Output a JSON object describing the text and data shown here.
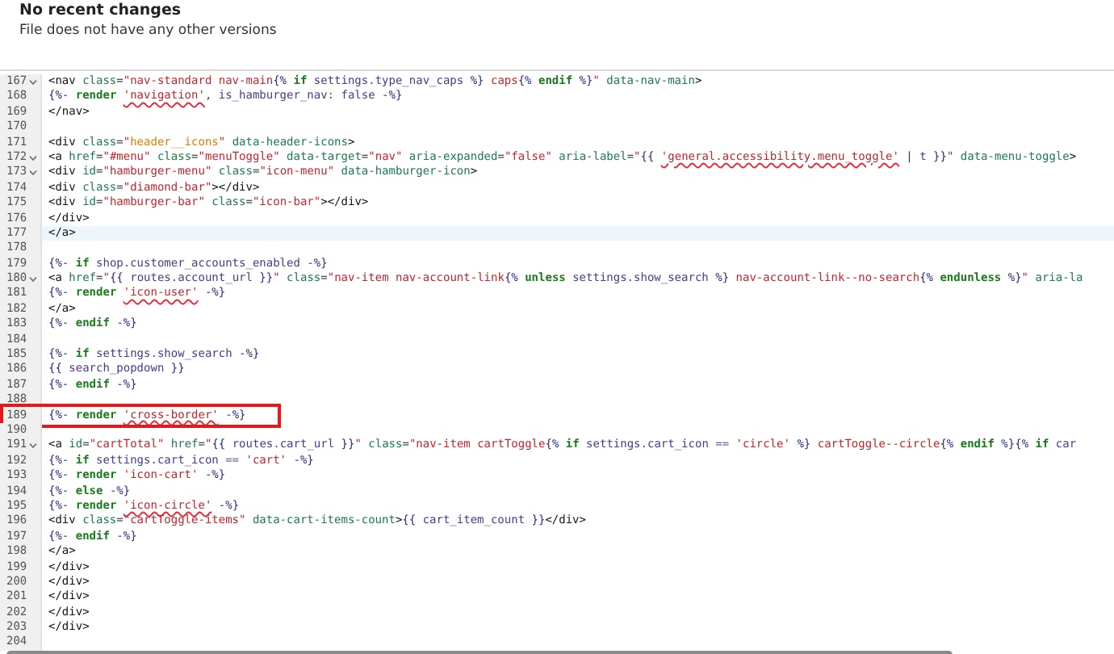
{
  "header": {
    "title": "No recent changes",
    "subtitle": "File does not have any other versions"
  },
  "lines": [
    {
      "number": "167",
      "foldable": true,
      "current": false,
      "highlighted": false,
      "tokens": [
        {
          "kind": "tag",
          "text": "<nav "
        },
        {
          "kind": "attr",
          "text": "class"
        },
        {
          "kind": "tag",
          "text": "="
        },
        {
          "kind": "string",
          "text": "\"nav-standard nav-main"
        },
        {
          "kind": "delim",
          "text": "{%"
        },
        {
          "kind": "keyword",
          "text": " if "
        },
        {
          "kind": "var",
          "text": "settings.type_nav_caps"
        },
        {
          "kind": "delim",
          "text": " %}"
        },
        {
          "kind": "string",
          "text": " caps"
        },
        {
          "kind": "delim",
          "text": "{%"
        },
        {
          "kind": "keyword",
          "text": " endif "
        },
        {
          "kind": "delim",
          "text": "%}"
        },
        {
          "kind": "string",
          "text": "\""
        },
        {
          "kind": "attr",
          "text": " data-nav-main"
        },
        {
          "kind": "tag",
          "text": ">"
        }
      ]
    },
    {
      "number": "168",
      "foldable": false,
      "current": false,
      "highlighted": false,
      "tokens": [
        {
          "kind": "delim",
          "text": "{%-"
        },
        {
          "kind": "keyword",
          "text": " render "
        },
        {
          "kind": "string",
          "text": "'navigation'",
          "flagged": true
        },
        {
          "kind": "var",
          "text": ", is_hamburger_nav: false "
        },
        {
          "kind": "delim",
          "text": "-%}"
        }
      ]
    },
    {
      "number": "169",
      "foldable": false,
      "current": false,
      "highlighted": false,
      "tokens": [
        {
          "kind": "tag",
          "text": "</nav>"
        }
      ]
    },
    {
      "number": "170",
      "foldable": false,
      "current": false,
      "highlighted": false
    },
    {
      "number": "171",
      "foldable": false,
      "current": false,
      "highlighted": false,
      "tokens": [
        {
          "kind": "tag",
          "text": "<div "
        },
        {
          "kind": "attr",
          "text": "class"
        },
        {
          "kind": "tag",
          "text": "="
        },
        {
          "kind": "string",
          "text": "\""
        },
        {
          "kind": "match",
          "text": "header__icons"
        },
        {
          "kind": "string",
          "text": "\""
        },
        {
          "kind": "attr",
          "text": " data-header-icons"
        },
        {
          "kind": "tag",
          "text": ">"
        }
      ]
    },
    {
      "number": "172",
      "foldable": true,
      "current": false,
      "highlighted": false,
      "tokens": [
        {
          "kind": "tag",
          "text": "<a "
        },
        {
          "kind": "attr",
          "text": "href"
        },
        {
          "kind": "tag",
          "text": "="
        },
        {
          "kind": "string",
          "text": "\"#menu\""
        },
        {
          "kind": "attr",
          "text": " class"
        },
        {
          "kind": "tag",
          "text": "="
        },
        {
          "kind": "string",
          "text": "\"menuToggle\""
        },
        {
          "kind": "attr",
          "text": " data-target"
        },
        {
          "kind": "tag",
          "text": "="
        },
        {
          "kind": "string",
          "text": "\"nav\""
        },
        {
          "kind": "attr",
          "text": " aria-expanded"
        },
        {
          "kind": "tag",
          "text": "="
        },
        {
          "kind": "string",
          "text": "\"false\""
        },
        {
          "kind": "attr",
          "text": " aria-label"
        },
        {
          "kind": "tag",
          "text": "="
        },
        {
          "kind": "string",
          "text": "\""
        },
        {
          "kind": "delim",
          "text": "{{ "
        },
        {
          "kind": "string",
          "text": "'general.accessibility.menu_toggle'",
          "flagged": true
        },
        {
          "kind": "delim",
          "text": " | "
        },
        {
          "kind": "var",
          "text": "t"
        },
        {
          "kind": "delim",
          "text": " }}"
        },
        {
          "kind": "string",
          "text": "\""
        },
        {
          "kind": "attr",
          "text": " data-menu-toggle"
        },
        {
          "kind": "tag",
          "text": ">"
        }
      ]
    },
    {
      "number": "173",
      "foldable": true,
      "current": false,
      "highlighted": false,
      "tokens": [
        {
          "kind": "tag",
          "text": "<div "
        },
        {
          "kind": "attr",
          "text": "id"
        },
        {
          "kind": "tag",
          "text": "="
        },
        {
          "kind": "string",
          "text": "\"hamburger-menu\""
        },
        {
          "kind": "attr",
          "text": " class"
        },
        {
          "kind": "tag",
          "text": "="
        },
        {
          "kind": "string",
          "text": "\"icon-menu\""
        },
        {
          "kind": "attr",
          "text": " data-hamburger-icon"
        },
        {
          "kind": "tag",
          "text": ">"
        }
      ]
    },
    {
      "number": "174",
      "foldable": false,
      "current": false,
      "highlighted": false,
      "tokens": [
        {
          "kind": "tag",
          "text": "<div "
        },
        {
          "kind": "attr",
          "text": "class"
        },
        {
          "kind": "tag",
          "text": "="
        },
        {
          "kind": "string",
          "text": "\"diamond-bar\""
        },
        {
          "kind": "tag",
          "text": "></div>"
        }
      ]
    },
    {
      "number": "175",
      "foldable": false,
      "current": false,
      "highlighted": false,
      "tokens": [
        {
          "kind": "tag",
          "text": "<div "
        },
        {
          "kind": "attr",
          "text": "id"
        },
        {
          "kind": "tag",
          "text": "="
        },
        {
          "kind": "string",
          "text": "\"hamburger-bar\""
        },
        {
          "kind": "attr",
          "text": " class"
        },
        {
          "kind": "tag",
          "text": "="
        },
        {
          "kind": "string",
          "text": "\"icon-bar\""
        },
        {
          "kind": "tag",
          "text": "></div>"
        }
      ]
    },
    {
      "number": "176",
      "foldable": false,
      "current": false,
      "highlighted": false,
      "tokens": [
        {
          "kind": "tag",
          "text": "</div>"
        }
      ]
    },
    {
      "number": "177",
      "foldable": false,
      "current": true,
      "highlighted": false,
      "tokens": [
        {
          "kind": "tag",
          "text": "</a>"
        }
      ]
    },
    {
      "number": "178",
      "foldable": false,
      "current": false,
      "highlighted": false
    },
    {
      "number": "179",
      "foldable": false,
      "current": false,
      "highlighted": false,
      "tokens": [
        {
          "kind": "delim",
          "text": "{%-"
        },
        {
          "kind": "keyword",
          "text": " if "
        },
        {
          "kind": "var",
          "text": "shop.customer_accounts_enabled "
        },
        {
          "kind": "delim",
          "text": "-%}"
        }
      ]
    },
    {
      "number": "180",
      "foldable": true,
      "current": false,
      "highlighted": false,
      "tokens": [
        {
          "kind": "tag",
          "text": "<a "
        },
        {
          "kind": "attr",
          "text": "href"
        },
        {
          "kind": "tag",
          "text": "="
        },
        {
          "kind": "string",
          "text": "\""
        },
        {
          "kind": "delim",
          "text": "{{ "
        },
        {
          "kind": "var",
          "text": "routes.account_url"
        },
        {
          "kind": "delim",
          "text": " }}"
        },
        {
          "kind": "string",
          "text": "\""
        },
        {
          "kind": "attr",
          "text": " class"
        },
        {
          "kind": "tag",
          "text": "="
        },
        {
          "kind": "string",
          "text": "\"nav-item nav-account-link"
        },
        {
          "kind": "delim",
          "text": "{%"
        },
        {
          "kind": "keyword",
          "text": " unless "
        },
        {
          "kind": "var",
          "text": "settings.show_search"
        },
        {
          "kind": "delim",
          "text": " %}"
        },
        {
          "kind": "string",
          "text": " nav-account-link--no-search"
        },
        {
          "kind": "delim",
          "text": "{%"
        },
        {
          "kind": "keyword",
          "text": " endunless "
        },
        {
          "kind": "delim",
          "text": "%}"
        },
        {
          "kind": "string",
          "text": "\""
        },
        {
          "kind": "attr",
          "text": " aria-la"
        }
      ]
    },
    {
      "number": "181",
      "foldable": false,
      "current": false,
      "highlighted": false,
      "tokens": [
        {
          "kind": "delim",
          "text": "{%-"
        },
        {
          "kind": "keyword",
          "text": " render "
        },
        {
          "kind": "string",
          "text": "'icon-user'",
          "flagged": true
        },
        {
          "kind": "delim",
          "text": " -%}"
        }
      ]
    },
    {
      "number": "182",
      "foldable": false,
      "current": false,
      "highlighted": false,
      "tokens": [
        {
          "kind": "tag",
          "text": "</a>"
        }
      ]
    },
    {
      "number": "183",
      "foldable": false,
      "current": false,
      "highlighted": false,
      "tokens": [
        {
          "kind": "delim",
          "text": "{%-"
        },
        {
          "kind": "keyword",
          "text": " endif "
        },
        {
          "kind": "delim",
          "text": "-%}"
        }
      ]
    },
    {
      "number": "184",
      "foldable": false,
      "current": false,
      "highlighted": false
    },
    {
      "number": "185",
      "foldable": false,
      "current": false,
      "highlighted": false,
      "tokens": [
        {
          "kind": "delim",
          "text": "{%-"
        },
        {
          "kind": "keyword",
          "text": " if "
        },
        {
          "kind": "var",
          "text": "settings.show_search "
        },
        {
          "kind": "delim",
          "text": "-%}"
        }
      ]
    },
    {
      "number": "186",
      "foldable": false,
      "current": false,
      "highlighted": false,
      "tokens": [
        {
          "kind": "delim",
          "text": "{{ "
        },
        {
          "kind": "var",
          "text": "search_popdown"
        },
        {
          "kind": "delim",
          "text": " }}"
        }
      ]
    },
    {
      "number": "187",
      "foldable": false,
      "current": false,
      "highlighted": false,
      "tokens": [
        {
          "kind": "delim",
          "text": "{%-"
        },
        {
          "kind": "keyword",
          "text": " endif "
        },
        {
          "kind": "delim",
          "text": "-%}"
        }
      ]
    },
    {
      "number": "188",
      "foldable": false,
      "current": false,
      "highlighted": false
    },
    {
      "number": "189",
      "foldable": false,
      "current": false,
      "highlighted": true,
      "tokens": [
        {
          "kind": "delim",
          "text": "{%-"
        },
        {
          "kind": "keyword",
          "text": " render "
        },
        {
          "kind": "string",
          "text": "'cross-border'",
          "flagged": true
        },
        {
          "kind": "delim",
          "text": " -%}"
        }
      ]
    },
    {
      "number": "190",
      "foldable": false,
      "current": false,
      "highlighted": false
    },
    {
      "number": "191",
      "foldable": true,
      "current": false,
      "highlighted": false,
      "tokens": [
        {
          "kind": "tag",
          "text": "<a "
        },
        {
          "kind": "attr",
          "text": "id"
        },
        {
          "kind": "tag",
          "text": "="
        },
        {
          "kind": "string",
          "text": "\"cartTotal\""
        },
        {
          "kind": "attr",
          "text": " href"
        },
        {
          "kind": "tag",
          "text": "="
        },
        {
          "kind": "string",
          "text": "\""
        },
        {
          "kind": "delim",
          "text": "{{ "
        },
        {
          "kind": "var",
          "text": "routes.cart_url"
        },
        {
          "kind": "delim",
          "text": " }}"
        },
        {
          "kind": "string",
          "text": "\""
        },
        {
          "kind": "attr",
          "text": " class"
        },
        {
          "kind": "tag",
          "text": "="
        },
        {
          "kind": "string",
          "text": "\"nav-item cartToggle"
        },
        {
          "kind": "delim",
          "text": "{%"
        },
        {
          "kind": "keyword",
          "text": " if "
        },
        {
          "kind": "var",
          "text": "settings.cart_icon == "
        },
        {
          "kind": "string",
          "text": "'circle'"
        },
        {
          "kind": "delim",
          "text": " %}"
        },
        {
          "kind": "string",
          "text": " cartToggle--circle"
        },
        {
          "kind": "delim",
          "text": "{%"
        },
        {
          "kind": "keyword",
          "text": " endif "
        },
        {
          "kind": "delim",
          "text": "%}{%"
        },
        {
          "kind": "keyword",
          "text": " if "
        },
        {
          "kind": "var",
          "text": "car"
        }
      ]
    },
    {
      "number": "192",
      "foldable": false,
      "current": false,
      "highlighted": false,
      "tokens": [
        {
          "kind": "delim",
          "text": "{%-"
        },
        {
          "kind": "keyword",
          "text": " if "
        },
        {
          "kind": "var",
          "text": "settings.cart_icon == "
        },
        {
          "kind": "string",
          "text": "'cart'"
        },
        {
          "kind": "delim",
          "text": " -%}"
        }
      ]
    },
    {
      "number": "193",
      "foldable": false,
      "current": false,
      "highlighted": false,
      "tokens": [
        {
          "kind": "delim",
          "text": "{%-"
        },
        {
          "kind": "keyword",
          "text": " render "
        },
        {
          "kind": "string",
          "text": "'icon-cart'"
        },
        {
          "kind": "delim",
          "text": " -%}"
        }
      ]
    },
    {
      "number": "194",
      "foldable": false,
      "current": false,
      "highlighted": false,
      "tokens": [
        {
          "kind": "delim",
          "text": "{%-"
        },
        {
          "kind": "keyword",
          "text": " else "
        },
        {
          "kind": "delim",
          "text": "-%}"
        }
      ]
    },
    {
      "number": "195",
      "foldable": false,
      "current": false,
      "highlighted": false,
      "tokens": [
        {
          "kind": "delim",
          "text": "{%-"
        },
        {
          "kind": "keyword",
          "text": " render "
        },
        {
          "kind": "string",
          "text": "'icon-circle'",
          "flagged": true
        },
        {
          "kind": "delim",
          "text": " -%}"
        }
      ]
    },
    {
      "number": "196",
      "foldable": false,
      "current": false,
      "highlighted": false,
      "tokens": [
        {
          "kind": "tag",
          "text": "<div "
        },
        {
          "kind": "attr",
          "text": "class"
        },
        {
          "kind": "tag",
          "text": "="
        },
        {
          "kind": "string",
          "text": "\"cartToggle-items\""
        },
        {
          "kind": "attr",
          "text": " data-cart-items-count"
        },
        {
          "kind": "tag",
          "text": ">"
        },
        {
          "kind": "delim",
          "text": "{{ "
        },
        {
          "kind": "var",
          "text": "cart_item_count"
        },
        {
          "kind": "delim",
          "text": " }}"
        },
        {
          "kind": "tag",
          "text": "</div>"
        }
      ]
    },
    {
      "number": "197",
      "foldable": false,
      "current": false,
      "highlighted": false,
      "tokens": [
        {
          "kind": "delim",
          "text": "{%-"
        },
        {
          "kind": "keyword",
          "text": " endif "
        },
        {
          "kind": "delim",
          "text": "-%}"
        }
      ]
    },
    {
      "number": "198",
      "foldable": false,
      "current": false,
      "highlighted": false,
      "tokens": [
        {
          "kind": "tag",
          "text": "</a>"
        }
      ]
    },
    {
      "number": "199",
      "foldable": false,
      "current": false,
      "highlighted": false,
      "tokens": [
        {
          "kind": "tag",
          "text": "</div>"
        }
      ]
    },
    {
      "number": "200",
      "foldable": false,
      "current": false,
      "highlighted": false,
      "tokens": [
        {
          "kind": "tag",
          "text": "</div>"
        }
      ]
    },
    {
      "number": "201",
      "foldable": false,
      "current": false,
      "highlighted": false,
      "tokens": [
        {
          "kind": "tag",
          "text": "</div>"
        }
      ]
    },
    {
      "number": "202",
      "foldable": false,
      "current": false,
      "highlighted": false,
      "tokens": [
        {
          "kind": "tag",
          "text": "</div>"
        }
      ]
    },
    {
      "number": "203",
      "foldable": false,
      "current": false,
      "highlighted": false,
      "tokens": [
        {
          "kind": "tag",
          "text": "</div>"
        }
      ]
    },
    {
      "number": "204",
      "foldable": false,
      "current": false,
      "highlighted": false
    }
  ]
}
